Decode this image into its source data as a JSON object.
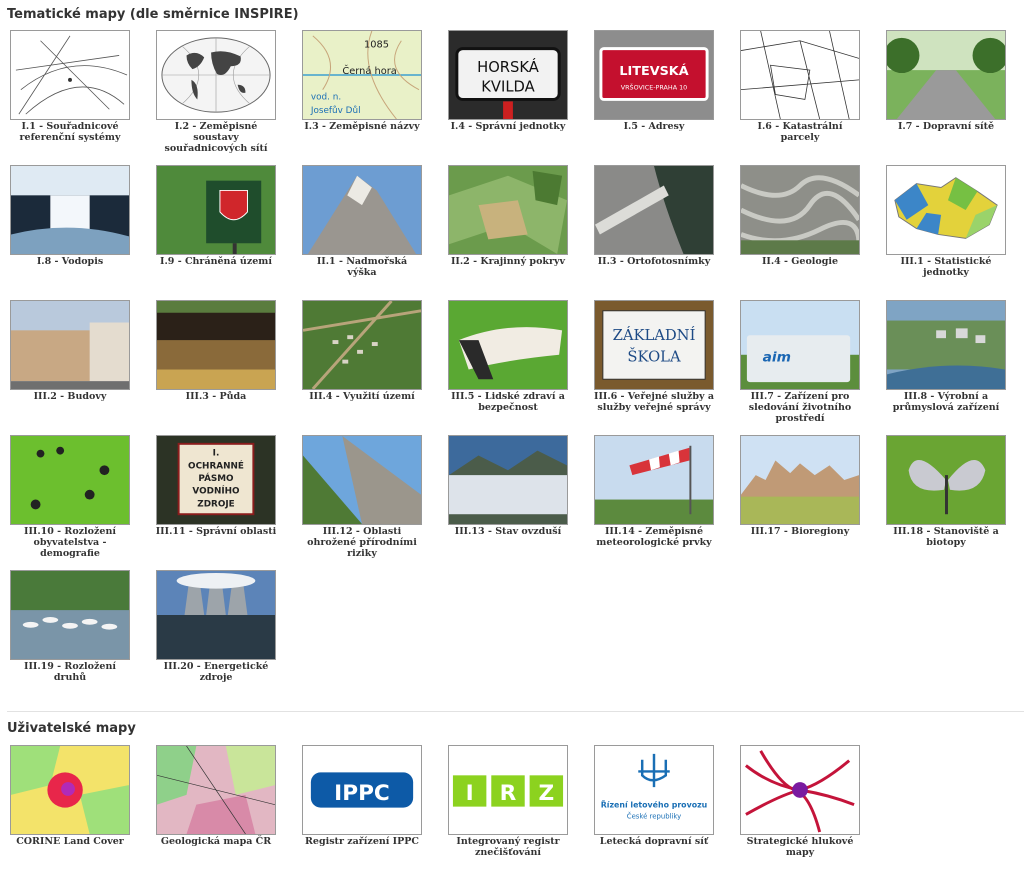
{
  "thematic": {
    "title": "Tematické mapy (dle směrnice INSPIRE)",
    "items": [
      {
        "label": "I.1 - Souřadnicové referenční systémy",
        "icon": "coordinate-grid"
      },
      {
        "label": "I.2 - Zeměpisné soustavy souřadnicových sítí",
        "icon": "world-map"
      },
      {
        "label": "I.3 - Zeměpisné názvy",
        "icon": "topo-map",
        "text": [
          "1085",
          "Černá hora",
          "vod. n.",
          "Josefův Důl"
        ]
      },
      {
        "label": "I.4 - Správní jednotky",
        "icon": "sign-white",
        "text": [
          "HORSKÁ",
          "KVILDA"
        ]
      },
      {
        "label": "I.5 - Adresy",
        "icon": "street-sign",
        "text": [
          "LITEVSKÁ",
          "VRŠOVICE-PRAHA 10"
        ]
      },
      {
        "label": "I.6 - Katastrální parcely",
        "icon": "cadastral"
      },
      {
        "label": "I.7 - Dopravní sítě",
        "icon": "road"
      },
      {
        "label": "I.8 - Vodopis",
        "icon": "waterfall"
      },
      {
        "label": "I.9 - Chráněná území",
        "icon": "protected-sign"
      },
      {
        "label": "II.1 - Nadmořská výška",
        "icon": "mountain"
      },
      {
        "label": "II.2 - Krajinný pokryv",
        "icon": "land-cover"
      },
      {
        "label": "II.3 - Ortofotosnímky",
        "icon": "orthophoto"
      },
      {
        "label": "II.4 - Geologie",
        "icon": "rock"
      },
      {
        "label": "III.1 - Statistické jednotky",
        "icon": "czech-map"
      },
      {
        "label": "III.2 - Budovy",
        "icon": "buildings"
      },
      {
        "label": "III.3 - Půda",
        "icon": "soil"
      },
      {
        "label": "III.4 - Využití území",
        "icon": "village"
      },
      {
        "label": "III.5 - Lidské zdraví a bezpečnost",
        "icon": "cast"
      },
      {
        "label": "III.6 - Veřejné služby a služby veřejné správy",
        "icon": "school-sign",
        "text": [
          "ZÁKLADNÍ",
          "ŠKOLA"
        ]
      },
      {
        "label": "III.7 - Zařízení pro sledování životního prostředí",
        "icon": "station",
        "text": [
          "aim"
        ]
      },
      {
        "label": "III.8 - Výrobní a průmyslová zařízení",
        "icon": "industry"
      },
      {
        "label": "III.10 - Rozložení obyvatelstva - demografie",
        "icon": "people"
      },
      {
        "label": "III.11 - Správní oblasti",
        "icon": "water-sign",
        "text": [
          "I.",
          "OCHRANNÉ",
          "PÁSMO",
          "VODNÍHO",
          "ZDROJE"
        ]
      },
      {
        "label": "III.12 - Oblasti ohrožené přírodními riziky",
        "icon": "landslide"
      },
      {
        "label": "III.13 - Stav ovzduší",
        "icon": "clouds"
      },
      {
        "label": "III.14 - Zeměpisné meteorologické prvky",
        "icon": "windsock"
      },
      {
        "label": "III.17 - Bioregiony",
        "icon": "bioregion"
      },
      {
        "label": "III.18 - Stanoviště a biotopy",
        "icon": "butterfly"
      },
      {
        "label": "III.19 - Rozložení druhů",
        "icon": "birds"
      },
      {
        "label": "III.20 - Energetické zdroje",
        "icon": "power-plant"
      }
    ]
  },
  "user": {
    "title": "Uživatelské mapy",
    "items": [
      {
        "label": "CORINE Land Cover",
        "icon": "corine-map"
      },
      {
        "label": "Geologická mapa ČR",
        "icon": "geology-map"
      },
      {
        "label": "Registr zařízení IPPC",
        "icon": "ippc-logo",
        "text": [
          "IPPC"
        ]
      },
      {
        "label": "Integrovaný registr znečišťování",
        "icon": "irz-logo",
        "text": [
          "I",
          "R",
          "Z"
        ]
      },
      {
        "label": "Letecká dopravní síť",
        "icon": "aviation-logo",
        "text": [
          "Řízení letového provozu",
          "České republiky"
        ]
      },
      {
        "label": "Strategické hlukové mapy",
        "icon": "noise-map"
      }
    ]
  },
  "colors": {
    "ippc": "#0d5aa7",
    "irz": "#8cd21f",
    "aviation": "#1a6fb5"
  }
}
